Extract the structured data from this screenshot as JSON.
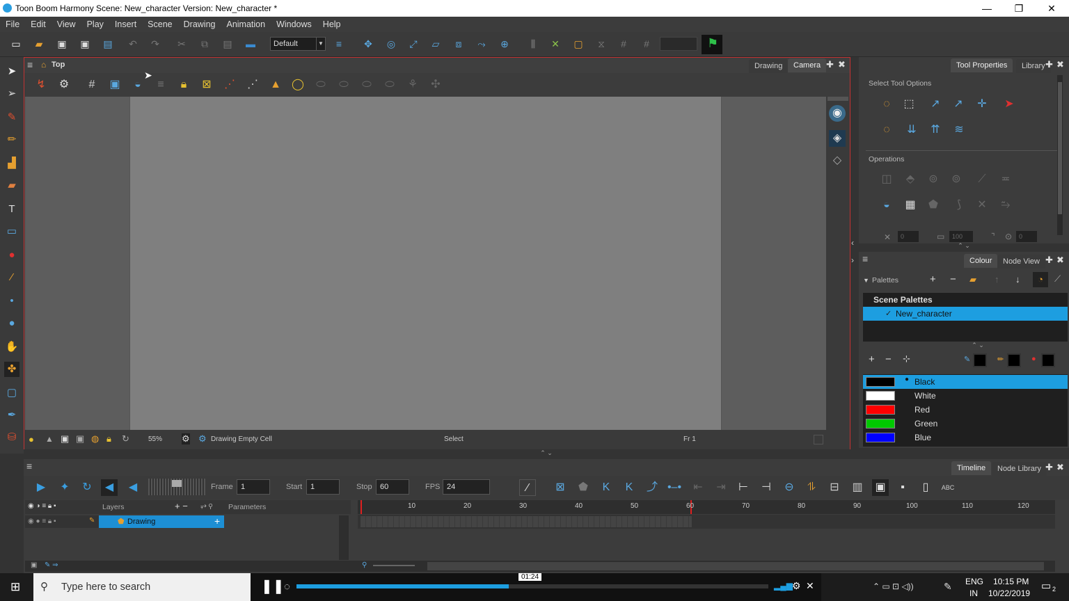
{
  "window": {
    "title": "Toon Boom Harmony Scene: New_character Version: New_character *",
    "minimize": "—",
    "restore": "❐",
    "close": "✕"
  },
  "menu": [
    "File",
    "Edit",
    "View",
    "Play",
    "Insert",
    "Scene",
    "Drawing",
    "Animation",
    "Windows",
    "Help"
  ],
  "toolbar": {
    "workspace_select": "Default"
  },
  "view": {
    "title": "Top",
    "tabs": [
      "Drawing",
      "Camera"
    ],
    "active_tab": "Camera",
    "status": {
      "zoom": "55%",
      "info": "Drawing Empty Cell",
      "tool": "Select",
      "frame": "Fr 1"
    }
  },
  "tool_properties": {
    "tabs": [
      "Tool Properties",
      "Library"
    ],
    "active_tab": "Tool Properties",
    "section_select": "Select Tool Options",
    "section_operations": "Operations",
    "field_values": [
      "0",
      "100",
      "0"
    ]
  },
  "colour_panel": {
    "tabs": [
      "Colour",
      "Node View"
    ],
    "active_tab": "Colour",
    "palettes_label": "Palettes",
    "scene_palettes_label": "Scene Palettes",
    "palette_check": "✓",
    "selected_palette": "New_character",
    "colors": [
      {
        "name": "Black",
        "hex": "#000000",
        "selected": true
      },
      {
        "name": "White",
        "hex": "#ffffff",
        "selected": false
      },
      {
        "name": "Red",
        "hex": "#ff0000",
        "selected": false
      },
      {
        "name": "Green",
        "hex": "#00c800",
        "selected": false
      },
      {
        "name": "Blue",
        "hex": "#0000ff",
        "selected": false
      }
    ]
  },
  "timeline": {
    "tabs": [
      "Timeline",
      "Node Library"
    ],
    "active_tab": "Timeline",
    "frame_label": "Frame",
    "frame": "1",
    "start_label": "Start",
    "start": "1",
    "stop_label": "Stop",
    "stop": "60",
    "fps_label": "FPS",
    "fps": "24",
    "layers_label": "Layers",
    "parameters_label": "Parameters",
    "layer_name": "Drawing",
    "ruler_ticks": [
      "10",
      "20",
      "30",
      "40",
      "50",
      "60",
      "70",
      "80",
      "90",
      "100",
      "110",
      "120"
    ]
  },
  "video_player": {
    "time": "01:24",
    "progress": 0.45
  },
  "taskbar": {
    "search_placeholder": "Type here to search",
    "lang": "ENG",
    "region": "IN",
    "time": "10:15 PM",
    "date": "10/22/2019",
    "notifications": "2"
  },
  "colors": {
    "accent": "#1d8fd4",
    "panel_border": "#c23232",
    "timeline_marker": "#e02020"
  }
}
